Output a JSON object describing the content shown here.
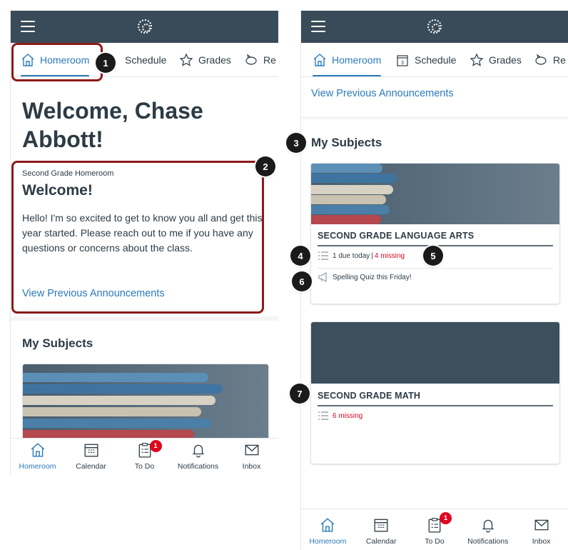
{
  "tabs": {
    "homeroom": "Homeroom",
    "schedule": "Schedule",
    "grades": "Grades",
    "resources": "Re"
  },
  "left": {
    "welcome": "Welcome, Chase Abbott!",
    "announcement": {
      "course": "Second Grade Homeroom",
      "title": "Welcome!",
      "body": "Hello! I'm so excited to get to know you all and get this year started. Please reach out to me if you have any questions or concerns about the class.",
      "link": "View Previous Announcements"
    },
    "subjects_title": "My Subjects"
  },
  "right": {
    "link": "View Previous Announcements",
    "subjects_title": "My Subjects",
    "cards": [
      {
        "title": "SECOND GRADE LANGUAGE ARTS",
        "due": "1 due today",
        "separator": "|",
        "missing": "4 missing",
        "announcement": "Spelling Quiz this Friday!"
      },
      {
        "title": "SECOND GRADE MATH",
        "missing": "6 missing"
      }
    ]
  },
  "bottom": {
    "homeroom": "Homeroom",
    "calendar": "Calendar",
    "todo": "To Do",
    "todo_badge": "1",
    "notifications": "Notifications",
    "inbox": "Inbox"
  },
  "callouts": [
    "1",
    "2",
    "3",
    "4",
    "5",
    "6",
    "7"
  ],
  "colors": {
    "topbar": "#394b58",
    "accent": "#2b7abc",
    "missing": "#e0061f",
    "highlight": "#8b1a1a",
    "card_header_math": "#3d4f5d"
  },
  "icons": [
    "menu-icon",
    "canvas-logo-icon",
    "home-icon",
    "calendar-icon",
    "star-icon",
    "piggy-bank-icon",
    "todo-icon",
    "bell-icon",
    "mail-icon",
    "checklist-icon",
    "megaphone-icon"
  ]
}
